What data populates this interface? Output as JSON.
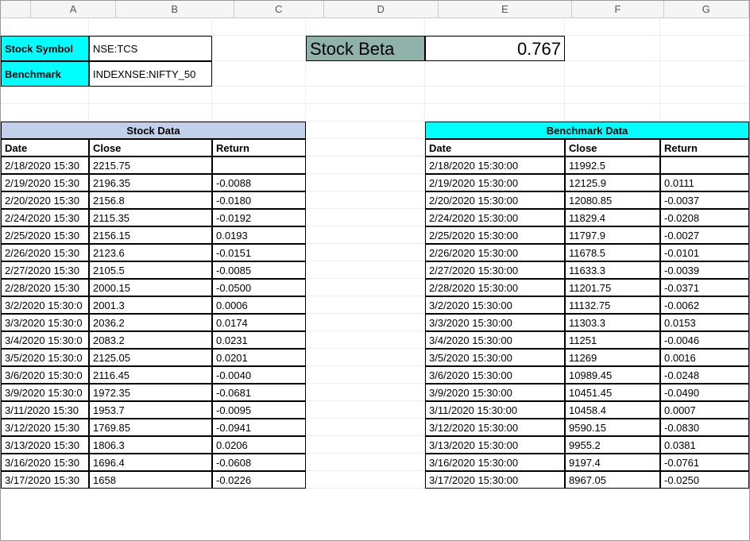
{
  "columns": [
    "A",
    "B",
    "C",
    "D",
    "E",
    "F",
    "G"
  ],
  "labels": {
    "stock_symbol": "Stock Symbol",
    "benchmark": "Benchmark",
    "stock_beta": "Stock Beta"
  },
  "values": {
    "stock_symbol": "NSE:TCS",
    "benchmark": "INDEXNSE:NIFTY_50",
    "stock_beta": "0.767"
  },
  "sections": {
    "stock_data": "Stock Data",
    "benchmark_data": "Benchmark Data"
  },
  "headers": {
    "date": "Date",
    "close": "Close",
    "return": "Return"
  },
  "stock_rows": [
    {
      "date": "2/18/2020 15:30",
      "close": "2215.75",
      "ret": ""
    },
    {
      "date": "2/19/2020 15:30",
      "close": "2196.35",
      "ret": "-0.0088"
    },
    {
      "date": "2/20/2020 15:30",
      "close": "2156.8",
      "ret": "-0.0180"
    },
    {
      "date": "2/24/2020 15:30",
      "close": "2115.35",
      "ret": "-0.0192"
    },
    {
      "date": "2/25/2020 15:30",
      "close": "2156.15",
      "ret": "0.0193"
    },
    {
      "date": "2/26/2020 15:30",
      "close": "2123.6",
      "ret": "-0.0151"
    },
    {
      "date": "2/27/2020 15:30",
      "close": "2105.5",
      "ret": "-0.0085"
    },
    {
      "date": "2/28/2020 15:30",
      "close": "2000.15",
      "ret": "-0.0500"
    },
    {
      "date": "3/2/2020 15:30:0",
      "close": "2001.3",
      "ret": "0.0006"
    },
    {
      "date": "3/3/2020 15:30:0",
      "close": "2036.2",
      "ret": "0.0174"
    },
    {
      "date": "3/4/2020 15:30:0",
      "close": "2083.2",
      "ret": "0.0231"
    },
    {
      "date": "3/5/2020 15:30:0",
      "close": "2125.05",
      "ret": "0.0201"
    },
    {
      "date": "3/6/2020 15:30:0",
      "close": "2116.45",
      "ret": "-0.0040"
    },
    {
      "date": "3/9/2020 15:30:0",
      "close": "1972.35",
      "ret": "-0.0681"
    },
    {
      "date": "3/11/2020 15:30",
      "close": "1953.7",
      "ret": "-0.0095"
    },
    {
      "date": "3/12/2020 15:30",
      "close": "1769.85",
      "ret": "-0.0941"
    },
    {
      "date": "3/13/2020 15:30",
      "close": "1806.3",
      "ret": "0.0206"
    },
    {
      "date": "3/16/2020 15:30",
      "close": "1696.4",
      "ret": "-0.0608"
    },
    {
      "date": "3/17/2020 15:30",
      "close": "1658",
      "ret": "-0.0226"
    }
  ],
  "bench_rows": [
    {
      "date": "2/18/2020 15:30:00",
      "close": "11992.5",
      "ret": ""
    },
    {
      "date": "2/19/2020 15:30:00",
      "close": "12125.9",
      "ret": "0.0111"
    },
    {
      "date": "2/20/2020 15:30:00",
      "close": "12080.85",
      "ret": "-0.0037"
    },
    {
      "date": "2/24/2020 15:30:00",
      "close": "11829.4",
      "ret": "-0.0208"
    },
    {
      "date": "2/25/2020 15:30:00",
      "close": "11797.9",
      "ret": "-0.0027"
    },
    {
      "date": "2/26/2020 15:30:00",
      "close": "11678.5",
      "ret": "-0.0101"
    },
    {
      "date": "2/27/2020 15:30:00",
      "close": "11633.3",
      "ret": "-0.0039"
    },
    {
      "date": "2/28/2020 15:30:00",
      "close": "11201.75",
      "ret": "-0.0371"
    },
    {
      "date": "3/2/2020 15:30:00",
      "close": "11132.75",
      "ret": "-0.0062"
    },
    {
      "date": "3/3/2020 15:30:00",
      "close": "11303.3",
      "ret": "0.0153"
    },
    {
      "date": "3/4/2020 15:30:00",
      "close": "11251",
      "ret": "-0.0046"
    },
    {
      "date": "3/5/2020 15:30:00",
      "close": "11269",
      "ret": "0.0016"
    },
    {
      "date": "3/6/2020 15:30:00",
      "close": "10989.45",
      "ret": "-0.0248"
    },
    {
      "date": "3/9/2020 15:30:00",
      "close": "10451.45",
      "ret": "-0.0490"
    },
    {
      "date": "3/11/2020 15:30:00",
      "close": "10458.4",
      "ret": "0.0007"
    },
    {
      "date": "3/12/2020 15:30:00",
      "close": "9590.15",
      "ret": "-0.0830"
    },
    {
      "date": "3/13/2020 15:30:00",
      "close": "9955.2",
      "ret": "0.0381"
    },
    {
      "date": "3/16/2020 15:30:00",
      "close": "9197.4",
      "ret": "-0.0761"
    },
    {
      "date": "3/17/2020 15:30:00",
      "close": "8967.05",
      "ret": "-0.0250"
    }
  ]
}
